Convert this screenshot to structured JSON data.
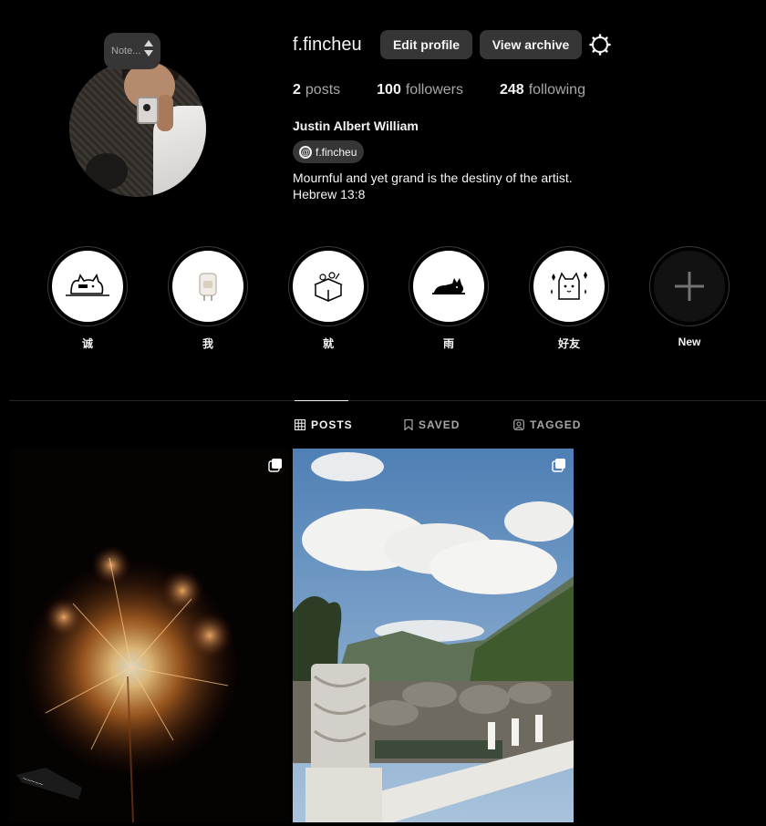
{
  "profile": {
    "note_text": "Note...",
    "username": "f.fincheu",
    "edit_profile_label": "Edit profile",
    "view_archive_label": "View archive",
    "stats": {
      "posts_count": "2",
      "posts_label": "posts",
      "followers_count": "100",
      "followers_label": "followers",
      "following_count": "248",
      "following_label": "following"
    },
    "full_name": "Justin Albert William",
    "threads_handle": "f.fincheu",
    "bio_line_1": "Mournful and yet grand is the destiny of the artist.",
    "bio_line_2": "Hebrew 13:8"
  },
  "highlights": [
    {
      "label": "诚",
      "icon": "cat-lying-icon"
    },
    {
      "label": "我",
      "icon": "toast-icon"
    },
    {
      "label": "就",
      "icon": "box-flowers-icon"
    },
    {
      "label": "雨",
      "icon": "black-cat-icon"
    },
    {
      "label": "好友",
      "icon": "cat-sparkles-icon"
    },
    {
      "label": "New",
      "icon": "plus-icon"
    }
  ],
  "tabs": [
    {
      "label": "POSTS",
      "icon": "grid-icon",
      "active": true
    },
    {
      "label": "SAVED",
      "icon": "bookmark-icon",
      "active": false
    },
    {
      "label": "TAGGED",
      "icon": "tag-user-icon",
      "active": false
    }
  ],
  "posts": [
    {
      "subject": "fireworks",
      "icon": "carousel-icon"
    },
    {
      "subject": "sky-mountain-garden",
      "icon": "carousel-icon"
    }
  ],
  "colors": {
    "background": "#000000",
    "button": "#363636",
    "text": "#f5f5f5",
    "muted": "#a8a8a8"
  }
}
